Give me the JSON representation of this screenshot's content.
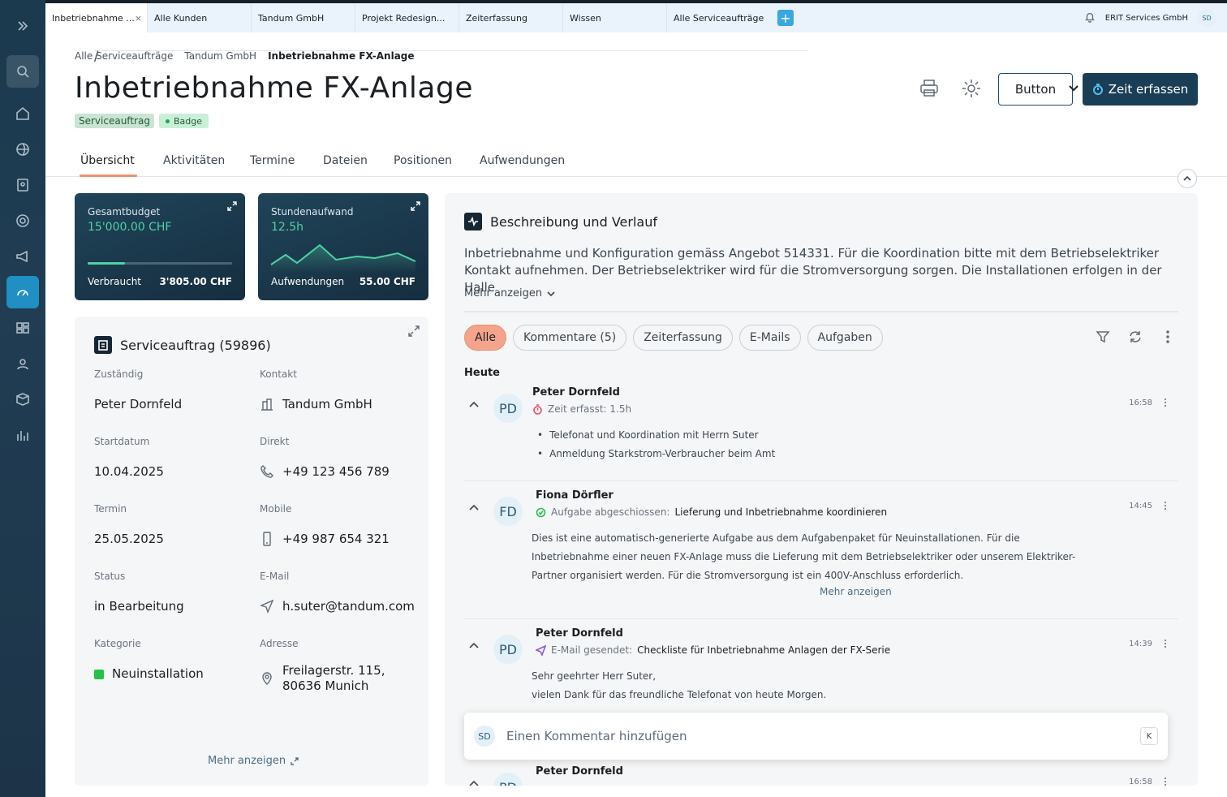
{
  "topbar": {
    "tabs": [
      {
        "label": "Inbetriebnahme ...",
        "close": "×"
      },
      {
        "label": "Alle Kunden"
      },
      {
        "label": "Tandum GmbH"
      },
      {
        "label": "Projekt Redesign..."
      },
      {
        "label": "Zeiterfassung"
      },
      {
        "label": "Wissen"
      },
      {
        "label": "Alle Serviceaufträge"
      }
    ],
    "add": "+",
    "company": "ERIT Services GmbH",
    "user_initials": "SD"
  },
  "breadcrumb": [
    "Alle Serviceaufträge",
    "Tandum GmbH",
    "Inbetriebnahme FX-Anlage"
  ],
  "breadcrumb_sep": "/",
  "page": {
    "title": "Inbetriebnahme FX-Anlage",
    "badge1": "Serviceauftrag",
    "badge2": "Badge",
    "button_label": "Button",
    "primary_label": "Zeit erfassen"
  },
  "tabs": [
    "Übersicht",
    "Aktivitäten",
    "Termine",
    "Dateien",
    "Positionen",
    "Aufwendungen"
  ],
  "kpis": {
    "budget": {
      "label": "Gesamtbudget",
      "value": "15'000.00 CHF",
      "sub_label": "Verbraucht",
      "sub_value": "3'805.00 CHF",
      "progress": 0.26
    },
    "hours": {
      "label": "Stundenaufwand",
      "value": "12.5h",
      "sub_label": "Aufwendungen",
      "sub_value": "55.00 CHF"
    }
  },
  "service_card": {
    "title": "Serviceauftrag (59896)",
    "fields": {
      "zustaendig": {
        "label": "Zuständig",
        "value": "Peter Dornfeld"
      },
      "kontakt": {
        "label": "Kontakt",
        "value": "Tandum GmbH"
      },
      "startdatum": {
        "label": "Startdatum",
        "value": "10.04.2025"
      },
      "direkt": {
        "label": "Direkt",
        "value": "+49 123 456 789"
      },
      "termin": {
        "label": "Termin",
        "value": "25.05.2025"
      },
      "mobile": {
        "label": "Mobile",
        "value": "+49 987 654 321"
      },
      "status": {
        "label": "Status",
        "value": "in Bearbeitung"
      },
      "email": {
        "label": "E-Mail",
        "value": "h.suter@tandum.com"
      },
      "kategorie": {
        "label": "Kategorie",
        "value": "Neuinstallation"
      },
      "adresse": {
        "label": "Adresse",
        "line1": "Freilagerstr. 115,",
        "line2": "80636 Munich"
      }
    },
    "more": "Mehr anzeigen"
  },
  "panel": {
    "title": "Beschreibung und Verlauf",
    "description": "Inbetriebnahme und Konfiguration gemäss Angebot 514331. Für die Koordination bitte mit dem Betriebselektriker Kontakt aufnehmen. Der Betriebselektriker wird für die Stromversorgung sorgen. Die Installationen erfolgen in der Halle",
    "more": "Mehr anzeigen",
    "chips": [
      "Alle",
      "Kommentare (5)",
      "Zeiterfassung",
      "E-Mails",
      "Aufgaben"
    ],
    "day": "Heute",
    "entries": [
      {
        "initials": "PD",
        "name": "Peter Dornfeld",
        "action": "Zeit erfasst: 1.5h",
        "time": "16:58",
        "bullets": [
          "Telefonat und Koordination mit Herrn Suter",
          "Anmeldung Starkstrom-Verbraucher beim Amt"
        ]
      },
      {
        "initials": "FD",
        "name": "Fiona Dörfler",
        "action": "Aufgabe abgeschiossen:",
        "action_target": "Lieferung und Inbetriebnahme koordinieren",
        "time": "14:45",
        "body": "Dies ist eine automatisch-generierte Aufgabe aus dem Aufgabenpaket für Neuinstallationen. Für die Inbetriebnahme einer neuen FX-Anlage muss die Lieferung mit dem Betriebselektriker oder unserem Elektriker-Partner organisiert werden. Für die Stromversorgung ist ein 400V-Anschluss erforderlich.",
        "more": "Mehr anzeigen"
      },
      {
        "initials": "PD",
        "name": "Peter Dornfeld",
        "action": "E-Mail gesendet:",
        "action_target": "Checkliste für Inbetriebnahme Anlagen der FX-Serie",
        "time": "14:39",
        "line1": "Sehr geehrter Herr Suter,",
        "line2": "vielen Dank für das freundliche Telefonat von heute Morgen."
      },
      {
        "initials": "PD",
        "name": "Peter Dornfeld",
        "time": "16:58"
      }
    ]
  },
  "comment": {
    "initials": "SD",
    "placeholder": "Einen Kommentar hinzufügen",
    "shortcut": "K"
  },
  "colors": {
    "accent": "#1a3e55",
    "active_tab": "#e8926a",
    "success": "#4fd1a5"
  }
}
